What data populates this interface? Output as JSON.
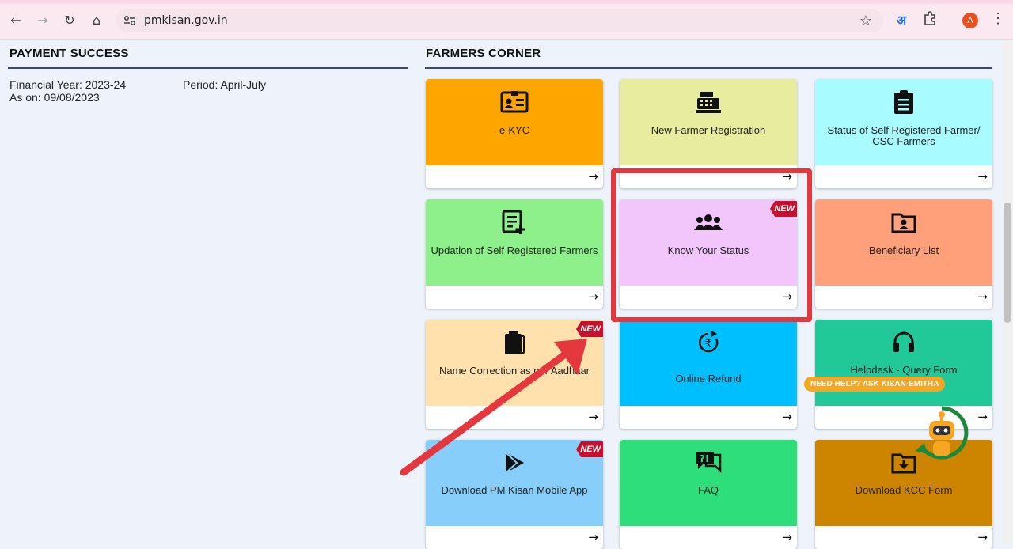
{
  "browser": {
    "url": "pmkisan.gov.in",
    "translate_glyph": "अ",
    "profile_initial": "A"
  },
  "payment": {
    "title": "PAYMENT SUCCESS",
    "financial_year": "Financial Year: 2023-24",
    "as_on": "As on: 09/08/2023",
    "period": "Period: April-July"
  },
  "farmers_corner": {
    "title": "FARMERS CORNER",
    "tiles": [
      {
        "label": "e-KYC",
        "color": "#ffa500",
        "icon": "id-card-icon"
      },
      {
        "label": "New Farmer Registration",
        "color": "#e8ec9f",
        "icon": "cash-register-icon"
      },
      {
        "label": "Status of Self Registered Farmer/ CSC Farmers",
        "color": "#a8fbff",
        "icon": "clipboard-list-icon"
      },
      {
        "label": "Updation of Self Registered Farmers",
        "color": "#8ef08a",
        "icon": "edit-list-icon"
      },
      {
        "label": "Know Your Status",
        "color": "#f3c6fb",
        "icon": "users-icon",
        "badge": "NEW"
      },
      {
        "label": "Beneficiary List",
        "color": "#ffa07a",
        "icon": "folder-user-icon"
      },
      {
        "label": "Name Correction as per Aadhaar",
        "color": "#ffe1ad",
        "icon": "clipboard-icon",
        "badge": "NEW"
      },
      {
        "label": "Online Refund",
        "color": "#00bfff",
        "icon": "rupee-refund-icon"
      },
      {
        "label": "Helpdesk - Query Form",
        "color": "#20c997",
        "icon": "headset-icon"
      },
      {
        "label": "Download PM Kisan Mobile App",
        "color": "#87cefa",
        "icon": "play-store-icon",
        "badge": "NEW"
      },
      {
        "label": "FAQ",
        "color": "#2ede7a",
        "icon": "faq-icon"
      },
      {
        "label": "Download KCC Form",
        "color": "#cd8500",
        "icon": "folder-download-icon"
      }
    ]
  },
  "help": {
    "pill": "NEED HELP? ASK KISAN-EMITRA"
  }
}
